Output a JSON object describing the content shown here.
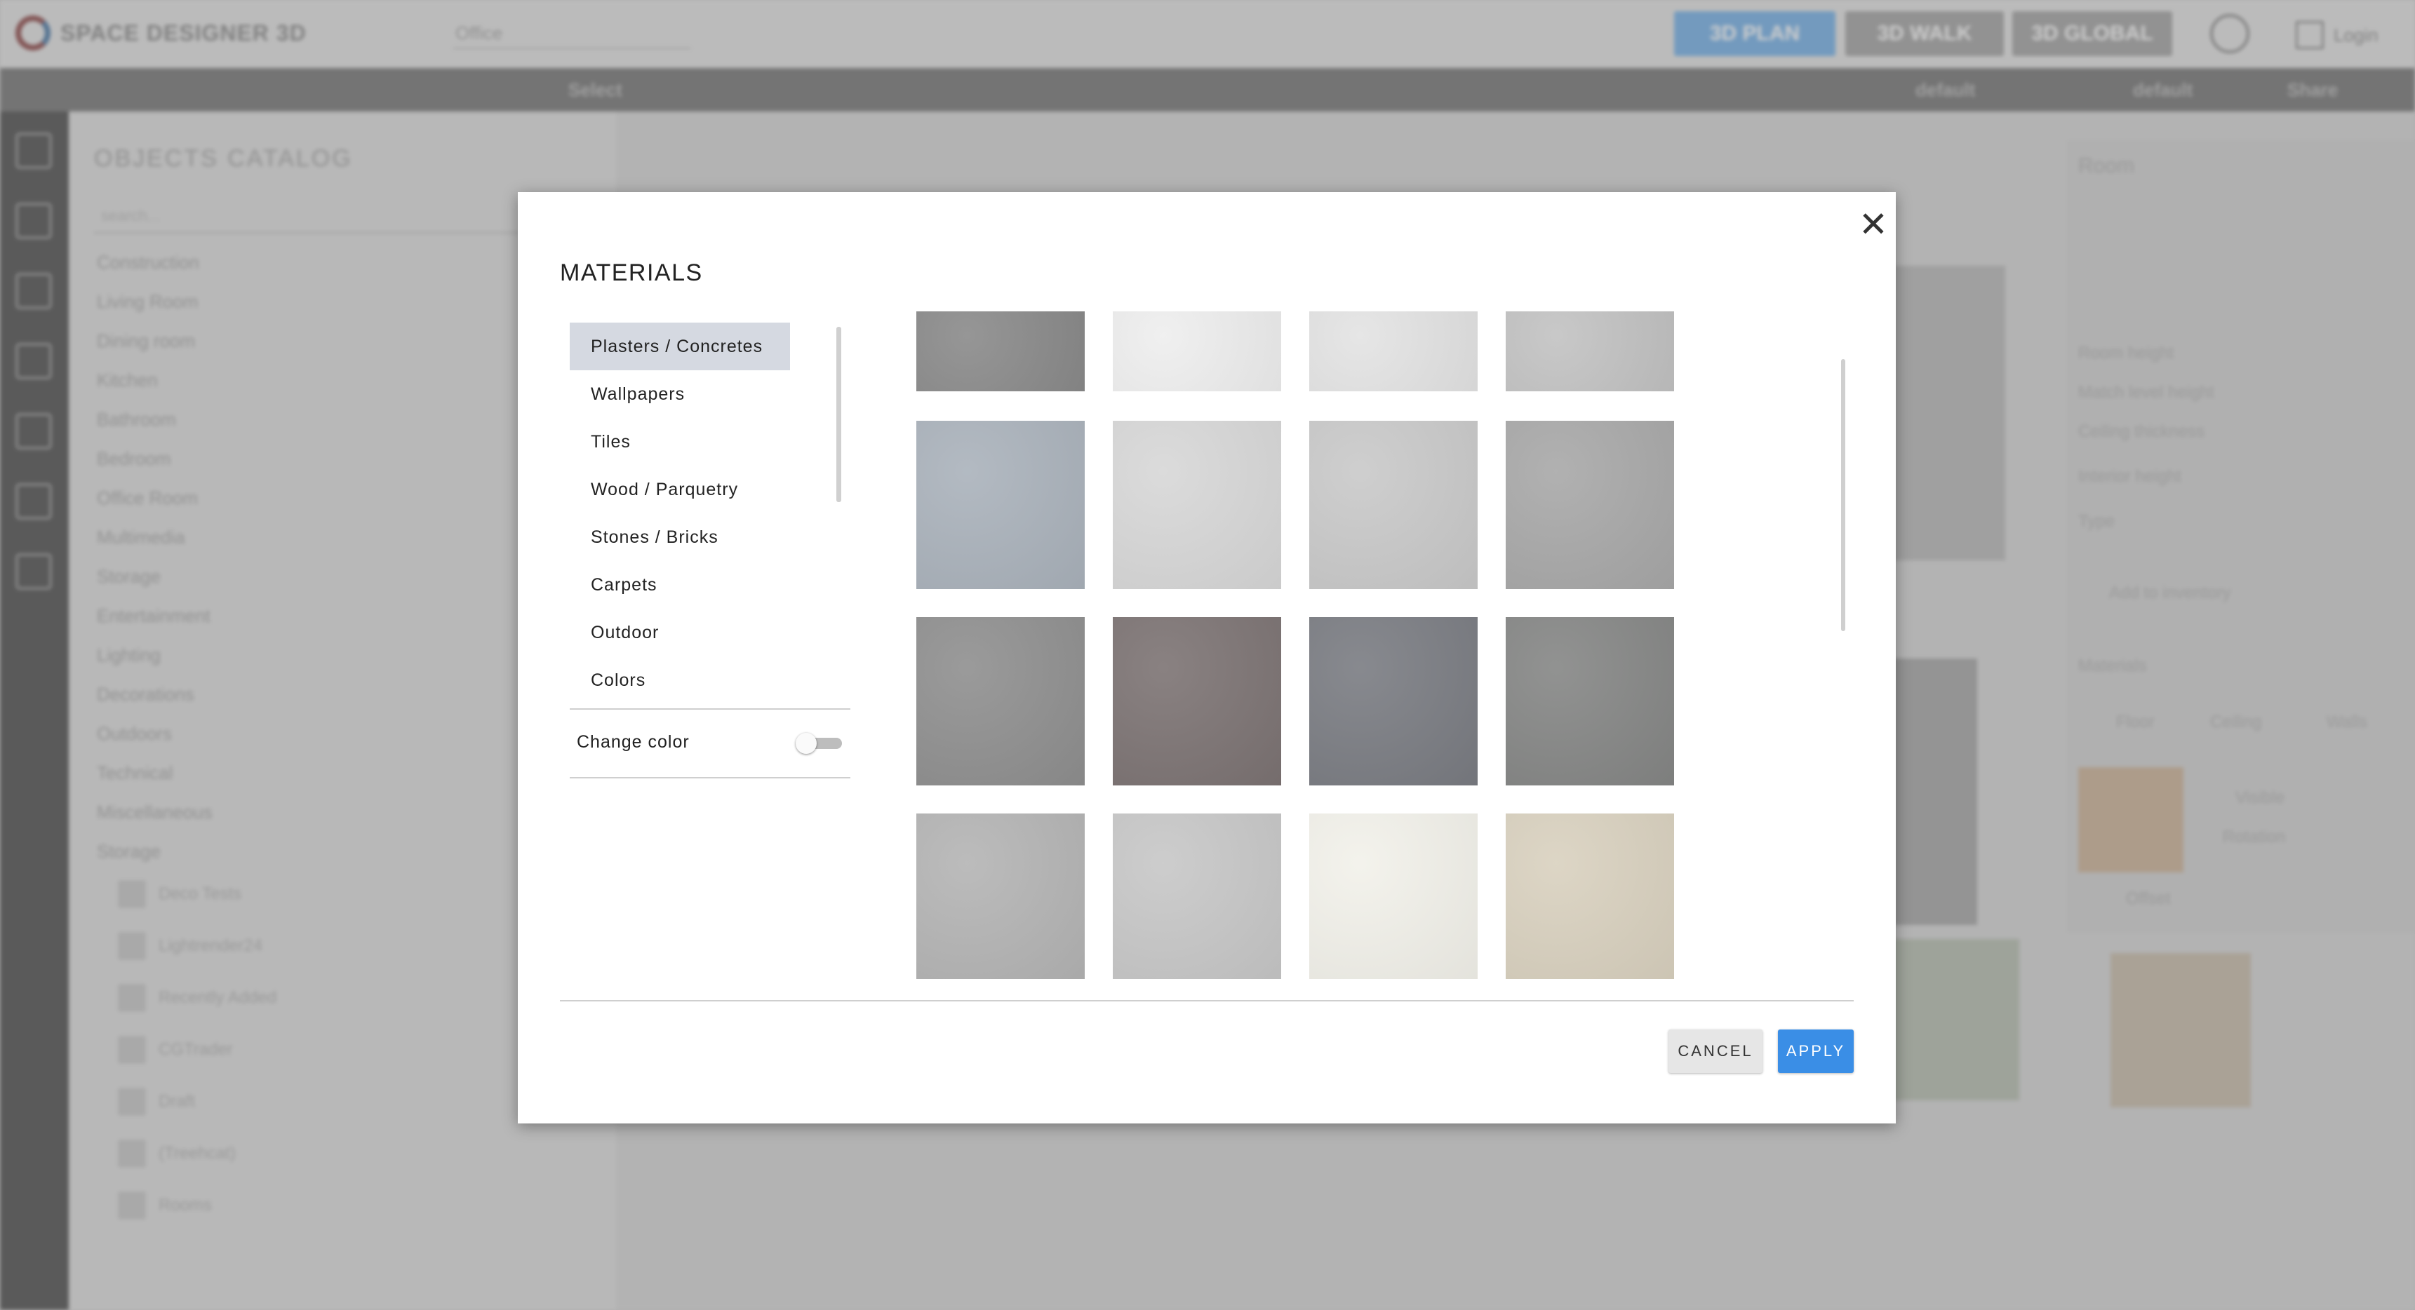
{
  "app": {
    "logo_text": "SPACE DESIGNER 3D",
    "project_name": "Office",
    "view_buttons": [
      "3D PLAN",
      "3D WALK",
      "3D GLOBAL"
    ],
    "login_label": "Login",
    "toolbar": {
      "select_label": "Select",
      "level_a": "default",
      "level_b": "default",
      "share_label": "Share"
    }
  },
  "catalog": {
    "title": "OBJECTS CATALOG",
    "search_placeholder": "search...",
    "categories": [
      "Construction",
      "Living Room",
      "Dining room",
      "Kitchen",
      "Bathroom",
      "Bedroom",
      "Office Room",
      "Multimedia",
      "Storage",
      "Entertainment",
      "Lighting",
      "Decorations",
      "Outdoors",
      "Technical",
      "Miscellaneous",
      "Storage"
    ],
    "subitems": [
      "Deco Tests",
      "Lightrender24",
      "Recently Added",
      "CGTrader",
      "Draft",
      "(Treehcat)",
      "Rooms"
    ]
  },
  "properties": {
    "title": "Room",
    "fields": [
      "Room height",
      "Match level height",
      "Ceiling thickness",
      "Interior height",
      "Type"
    ],
    "add_to_inventory": "Add to inventory",
    "materials_label": "Materials",
    "tabs": [
      "Floor",
      "Ceiling",
      "Walls"
    ],
    "visible_label": "Visible",
    "rotation_label": "Rotation",
    "offset_label": "Offset"
  },
  "modal": {
    "title": "MATERIALS",
    "close_label": "✕",
    "categories": [
      {
        "label": "Plasters / Concretes",
        "active": true
      },
      {
        "label": "Wallpapers",
        "active": false
      },
      {
        "label": "Tiles",
        "active": false
      },
      {
        "label": "Wood / Parquetry",
        "active": false
      },
      {
        "label": "Stones / Bricks",
        "active": false
      },
      {
        "label": "Carpets",
        "active": false
      },
      {
        "label": "Outdoor",
        "active": false
      },
      {
        "label": "Colors",
        "active": false
      }
    ],
    "change_color_label": "Change color",
    "change_color_on": false,
    "swatches": [
      [
        "#8a8a8a",
        "#eeeeee",
        "#e3e3e3",
        "#c2c2c2"
      ],
      [
        "#aab2bb",
        "#d7d7d7",
        "#c9c9c9",
        "#a8a8a8"
      ],
      [
        "#8f8f8f",
        "#7c7373",
        "#7a7c82",
        "#858685"
      ],
      [
        "#b4b4b4",
        "#c7c7c7",
        "#f2f1ea",
        "#d9d1bf"
      ]
    ],
    "cancel_label": "CANCEL",
    "apply_label": "APPLY"
  }
}
